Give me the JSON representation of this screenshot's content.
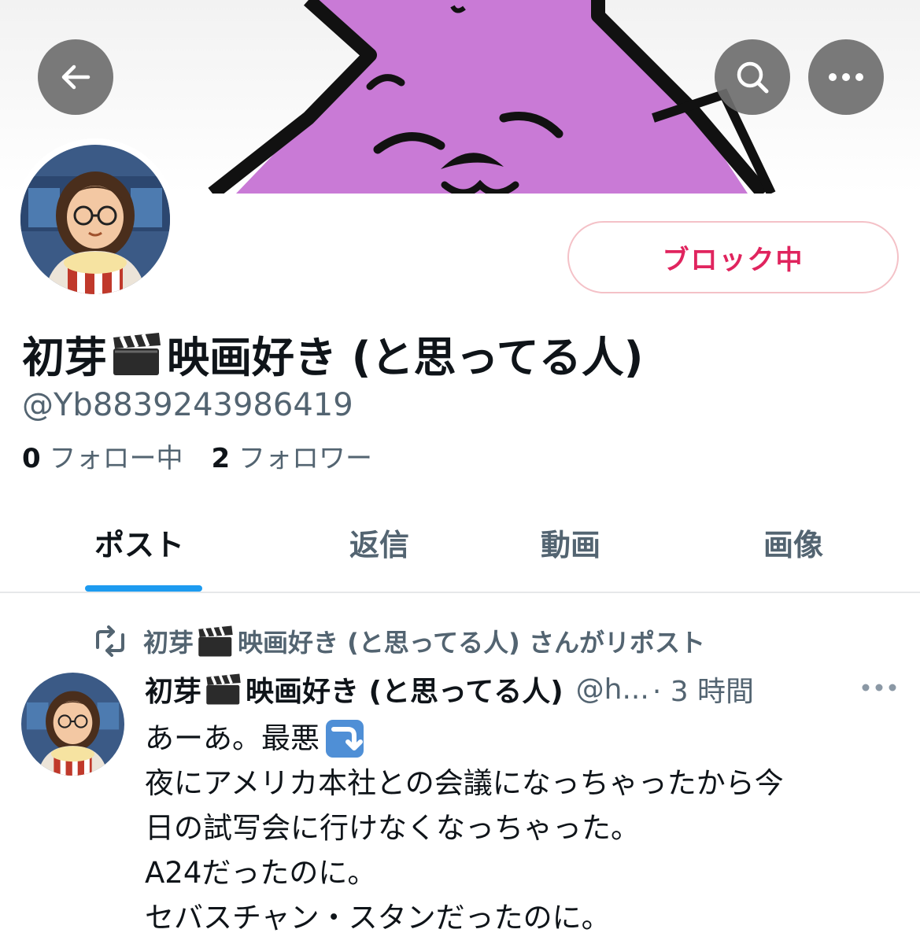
{
  "header": {
    "back_icon": "arrow-left-icon",
    "search_icon": "search-icon",
    "more_icon": "more-horizontal-icon"
  },
  "profile": {
    "display_name_part1": "初芽",
    "display_name_emoji": "clapper-board-icon",
    "display_name_part2": "映画好き (と思ってる人)",
    "handle": "@Yb8839243986419",
    "block_button_label": "ブロック中",
    "following_count": "0",
    "following_label": "フォロー中",
    "followers_count": "2",
    "followers_label": "フォロワー"
  },
  "tabs": [
    {
      "label": "ポスト",
      "active": true
    },
    {
      "label": "返信",
      "active": false
    },
    {
      "label": "動画",
      "active": false
    },
    {
      "label": "画像",
      "active": false
    }
  ],
  "post": {
    "repost_name_part1": "初芽",
    "repost_name_part2": "映画好き (と思ってる人) さんがリポスト",
    "author_name_part1": "初芽",
    "author_name_part2": "映画好き (と思ってる人)",
    "author_handle": "@h...",
    "time": "· 3 時間",
    "lines": [
      "あーあ。最悪",
      "夜にアメリカ本社との会議になっちゃったから今",
      "日の試写会に行けなくなっちゃった。",
      "A24だったのに。",
      "セバスチャン・スタンだったのに。"
    ]
  },
  "colors": {
    "accent": "#1d9bf0",
    "block_red": "#e0245e",
    "secondary_text": "#536471"
  }
}
